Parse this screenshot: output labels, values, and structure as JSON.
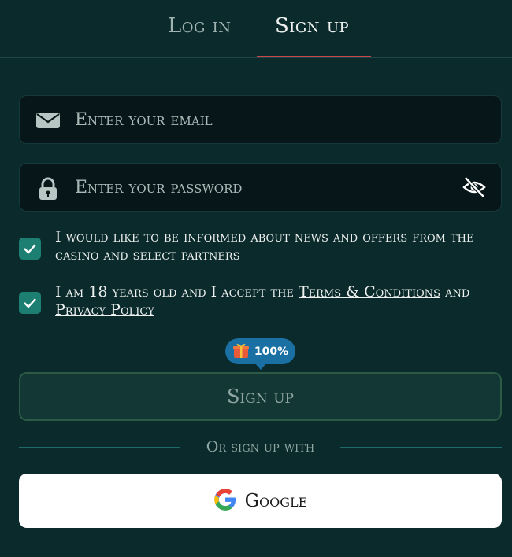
{
  "tabs": [
    {
      "label": "Log in",
      "active": false
    },
    {
      "label": "Sign up",
      "active": true
    }
  ],
  "email": {
    "placeholder": "Enter your email",
    "icon": "envelope-icon"
  },
  "password": {
    "placeholder": "Enter your password",
    "icon": "lock-icon",
    "toggle_icon": "eye-slash-icon"
  },
  "consents": {
    "news": {
      "checked": true,
      "text": "I would like to be informed about news and offers from the casino and select partners"
    },
    "terms": {
      "checked": true,
      "prefix": "I am 18 years old and I accept the ",
      "terms_link": "Terms & Conditions",
      "middle": " and ",
      "privacy_link": "Privacy Policy"
    }
  },
  "progress_badge": {
    "icon": "gift-icon",
    "value": "100%"
  },
  "signup_button": {
    "label": "Sign up"
  },
  "divider": {
    "text": "Or sign up with"
  },
  "google_button": {
    "icon": "google-icon",
    "label": "Google"
  },
  "colors": {
    "background": "#0b2a2b",
    "accent": "#c7484a",
    "checkbox": "#1d7f72",
    "badge": "#1a6fa3"
  }
}
